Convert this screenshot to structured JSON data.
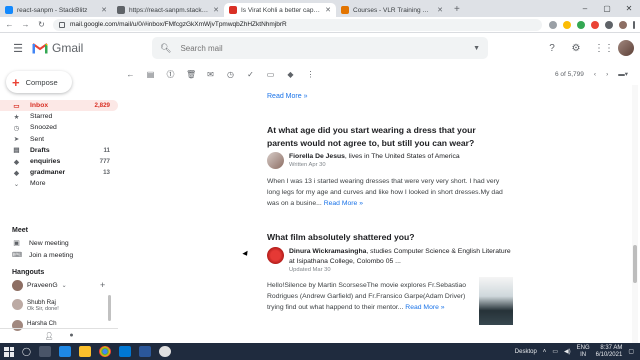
{
  "browser": {
    "tabs": [
      {
        "title": "react-sanpm - StackBlitz",
        "color": "#1389fd",
        "active": false
      },
      {
        "title": "https://react-sanpm.stackblitz.io",
        "color": "#5f6368",
        "active": false
      },
      {
        "title": "Is Virat Kohli a better captain th...",
        "color": "#d93025",
        "active": true
      },
      {
        "title": "Courses - VLR Training Software",
        "color": "#e37400",
        "active": false
      }
    ],
    "url": "mail.google.com/mail/u/0/#inbox/FMfcgzGkXmWjvTpmwqbZhHZktNhmjbrR"
  },
  "gmail": {
    "brand": "Gmail",
    "search_placeholder": "Search mail",
    "compose_label": "Compose",
    "folders": [
      {
        "label": "Inbox",
        "count": "2,829",
        "icon": "inbox-icon",
        "glyph": "▭",
        "active": true,
        "bold": true
      },
      {
        "label": "Starred",
        "count": "",
        "icon": "star-icon",
        "glyph": "★",
        "active": false,
        "bold": false
      },
      {
        "label": "Snoozed",
        "count": "",
        "icon": "clock-icon",
        "glyph": "◷",
        "active": false,
        "bold": false
      },
      {
        "label": "Sent",
        "count": "",
        "icon": "send-icon",
        "glyph": "➤",
        "active": false,
        "bold": false
      },
      {
        "label": "Drafts",
        "count": "11",
        "icon": "draft-icon",
        "glyph": "▤",
        "active": false,
        "bold": true
      },
      {
        "label": "enquiries",
        "count": "777",
        "icon": "label-icon",
        "glyph": "◆",
        "active": false,
        "bold": true
      },
      {
        "label": "gradmaner",
        "count": "13",
        "icon": "label-icon",
        "glyph": "◆",
        "active": false,
        "bold": true
      },
      {
        "label": "More",
        "count": "",
        "icon": "chevron-down-icon",
        "glyph": "⌄",
        "active": false,
        "bold": false
      }
    ],
    "meet": {
      "title": "Meet",
      "new_meeting": "New meeting",
      "join_meeting": "Join a meeting"
    },
    "hangouts": {
      "title": "Hangouts",
      "user": "PraveenG",
      "contacts": [
        {
          "name": "Shubh Raj",
          "status": "Ok Sir, done!"
        },
        {
          "name": "Harsha Ch",
          "status": ""
        }
      ]
    },
    "pager": "6 of 5,799"
  },
  "content": {
    "readmore_top": "Read More »",
    "posts": [
      {
        "question": "At what age did you start wearing a dress that your parents would not agree to, but still you can wear?",
        "author": "Fiorella De Jesus",
        "author_info": ", lives in The United States of America",
        "date": "Written Apr 30",
        "body": "When I was 13 i started wearing dresses that were very very short. I had very long legs for my age and curves and like how I looked in short dresses.My dad was on a busine...",
        "readmore": "Read More »"
      },
      {
        "question": "What film absolutely shattered you?",
        "author": "Dinura Wickramasingha",
        "author_info": ", studies Computer Science & English Literature at Isipathana College, Colombo 05 ...",
        "date": "Updated Mar 30",
        "body": "Hello!Silence by Martin ScorseseThe movie explores Fr.Sebastiao Rodrigues (Andrew Garfield) and Fr.Fransico Garpe(Adam Driver) trying find out what happend to their mentor...",
        "readmore": "Read More »"
      }
    ]
  },
  "taskbar": {
    "desktop": "Desktop",
    "lang_line1": "ENG",
    "lang_line2": "IN",
    "time": "8:37 AM",
    "date": "6/10/2021"
  }
}
